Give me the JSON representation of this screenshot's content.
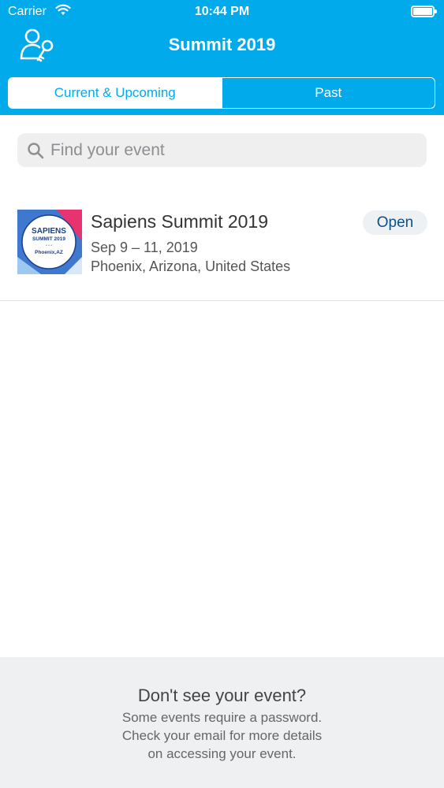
{
  "status_bar": {
    "carrier": "Carrier",
    "time": "10:44 PM"
  },
  "header": {
    "title": "Summit 2019",
    "background_color": "#00aaeb",
    "account_icon": "user-key-icon"
  },
  "tabs": [
    {
      "label": "Current & Upcoming",
      "selected": true
    },
    {
      "label": "Past",
      "selected": false
    }
  ],
  "search": {
    "placeholder": "Find your event",
    "value": ""
  },
  "events": [
    {
      "name": "Sapiens Summit 2019",
      "dates": "Sep 9 – 11, 2019",
      "location": "Phoenix, Arizona, United States",
      "action": "Open",
      "thumbnail": {
        "line1": "SAPIENS",
        "line2": "SUMMIT 2019",
        "line3": "Phoenix,AZ"
      }
    }
  ],
  "footer": {
    "title": "Don't see your event?",
    "lines": [
      "Some events require a password.",
      "Check your email for more details",
      "on accessing your event."
    ]
  }
}
